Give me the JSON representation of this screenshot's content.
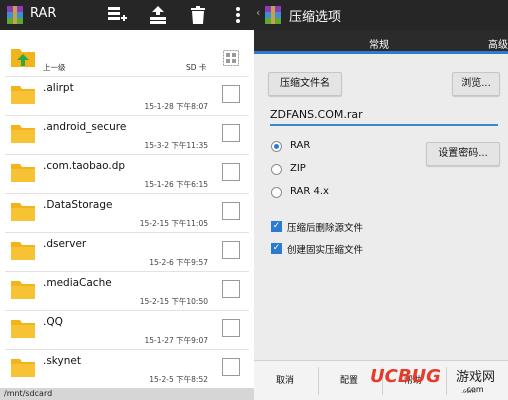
{
  "left": {
    "app_title": "RAR",
    "toolbar_icons": [
      "add-archive-icon",
      "extract-icon",
      "delete-icon",
      "more-menu-icon"
    ],
    "parent": {
      "label": "上一级",
      "location": "SD 卡"
    },
    "files": [
      {
        "name": ".alirpt",
        "date": "15-1-28 下午8:07"
      },
      {
        "name": ".android_secure",
        "date": "15-3-2 下午11:35"
      },
      {
        "name": ".com.taobao.dp",
        "date": "15-1-26 下午6:15"
      },
      {
        "name": ".DataStorage",
        "date": "15-2-15 下午11:05"
      },
      {
        "name": ".dserver",
        "date": "15-2-6 下午9:57"
      },
      {
        "name": ".mediaCache",
        "date": "15-2-15 下午10:50"
      },
      {
        "name": ".QQ",
        "date": "15-1-27 下午9:07"
      },
      {
        "name": ".skynet",
        "date": "15-2-5 下午8:52"
      }
    ],
    "path": "/mnt/sdcard"
  },
  "right": {
    "title": "压缩选项",
    "tabs": {
      "general": "常规",
      "advanced": "高级"
    },
    "archive_name_button": "压缩文件名",
    "browse_button": "浏览...",
    "filename_value": "ZDFANS.COM.rar",
    "formats": [
      {
        "label": "RAR",
        "selected": true
      },
      {
        "label": "ZIP",
        "selected": false
      },
      {
        "label": "RAR 4.x",
        "selected": false
      }
    ],
    "set_password_button": "设置密码...",
    "options": [
      {
        "label": "压缩后删除源文件",
        "checked": true
      },
      {
        "label": "创建固实压缩文件",
        "checked": true
      }
    ],
    "bottom": {
      "cancel": "取消",
      "profiles": "配置",
      "help": "帮助",
      "ok": ".com"
    },
    "watermark": {
      "brand": "UCBUG",
      "suffix": "游戏网",
      "url": ".com"
    }
  },
  "colors": {
    "accent": "#2d7bd0",
    "toolbar": "#262626",
    "folder": "#f3b31a"
  }
}
